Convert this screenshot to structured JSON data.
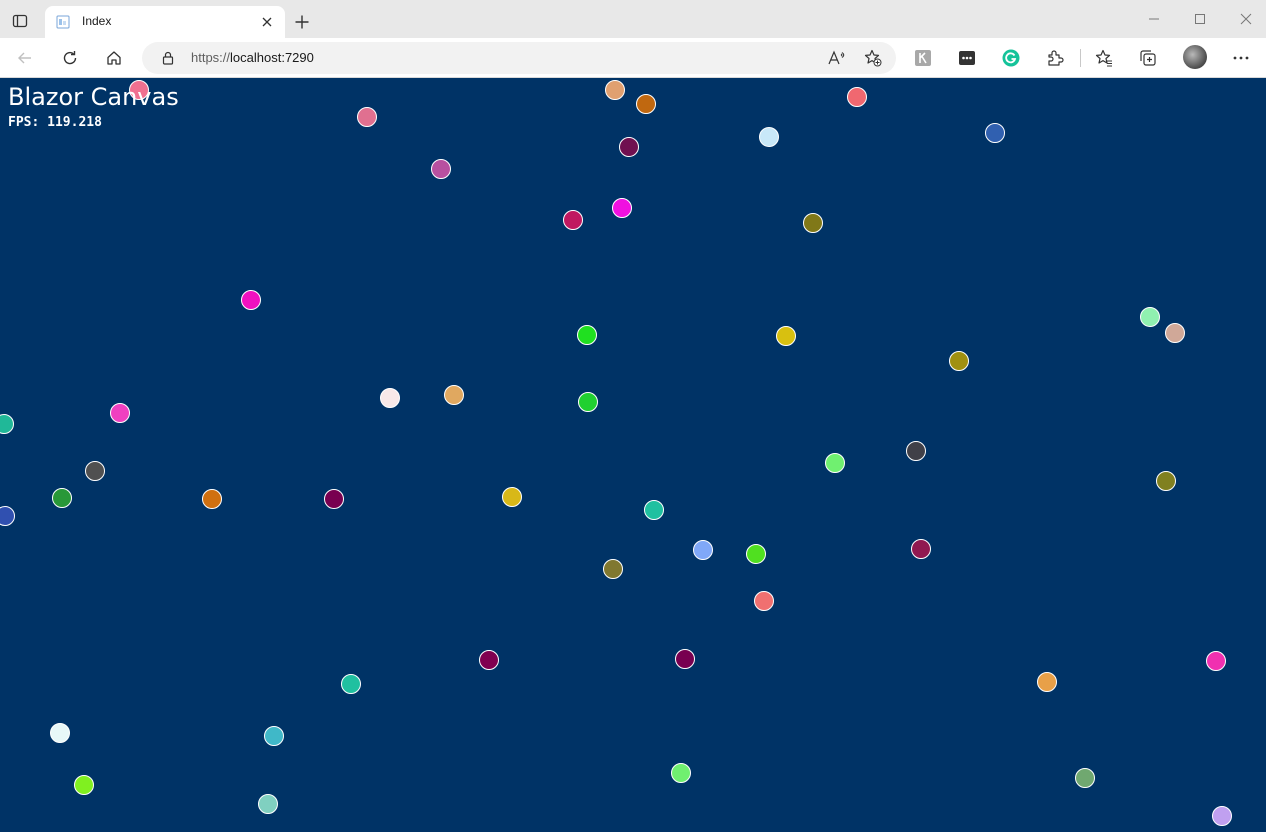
{
  "browser": {
    "tab": {
      "title": "Index",
      "close_label": "×"
    },
    "new_tab_label": "+",
    "address": {
      "scheme": "https://",
      "host": "localhost:7290"
    },
    "icons": [
      "tab-actions-icon",
      "page-favicon-icon",
      "close-icon",
      "plus-icon",
      "minimize-icon",
      "maximize-icon",
      "window-close-icon",
      "back-icon",
      "refresh-icon",
      "home-icon",
      "lock-icon",
      "read-aloud-icon",
      "add-favorite-icon",
      "extension-k-icon",
      "extension-password-icon",
      "grammarly-icon",
      "extensions-icon",
      "favorites-icon",
      "collections-icon",
      "profile-avatar",
      "more-icon"
    ]
  },
  "page": {
    "heading": "Blazor Canvas",
    "fps_label": "FPS:",
    "fps_value": "119.218",
    "background_color": "#003366"
  },
  "balls": [
    {
      "color": "#f07090"
    },
    {
      "color": "#e0a070"
    },
    {
      "color": "#c06810"
    },
    {
      "color": "#f06870"
    },
    {
      "color": "#e07090"
    },
    {
      "color": "#c8e8f8"
    },
    {
      "color": "#3060b0"
    },
    {
      "color": "#701050"
    },
    {
      "color": "#b850a0"
    },
    {
      "color": "#c01860"
    },
    {
      "color": "#f010e0"
    },
    {
      "color": "#807818"
    },
    {
      "color": "#f010c0"
    },
    {
      "color": "#20e020"
    },
    {
      "color": "#d8c010"
    },
    {
      "color": "#90f0b0"
    },
    {
      "color": "#d0a898"
    },
    {
      "color": "#a09010"
    },
    {
      "color": "#20b898"
    },
    {
      "color": "#f040c0"
    },
    {
      "color": "#f8e8e8"
    },
    {
      "color": "#e0a860"
    },
    {
      "color": "#20d030"
    },
    {
      "color": "#505050"
    },
    {
      "color": "#70f070"
    },
    {
      "color": "#404048"
    },
    {
      "color": "#808020"
    },
    {
      "color": "#289838"
    },
    {
      "color": "#d07010"
    },
    {
      "color": "#780050"
    },
    {
      "color": "#d8b818"
    },
    {
      "color": "#3050b0"
    },
    {
      "color": "#20c0a0"
    },
    {
      "color": "#80a8f8"
    },
    {
      "color": "#50e020"
    },
    {
      "color": "#901850"
    },
    {
      "color": "#807830"
    },
    {
      "color": "#f07070"
    },
    {
      "color": "#800050"
    },
    {
      "color": "#780050"
    },
    {
      "color": "#20c0a0"
    },
    {
      "color": "#e8a048"
    },
    {
      "color": "#f030b0"
    },
    {
      "color": "#e8f8f8"
    },
    {
      "color": "#40b8c8"
    },
    {
      "color": "#80f020"
    },
    {
      "color": "#70f070"
    },
    {
      "color": "#70a870"
    },
    {
      "color": "#80d0c0"
    },
    {
      "color": "#c0a0f0"
    }
  ]
}
